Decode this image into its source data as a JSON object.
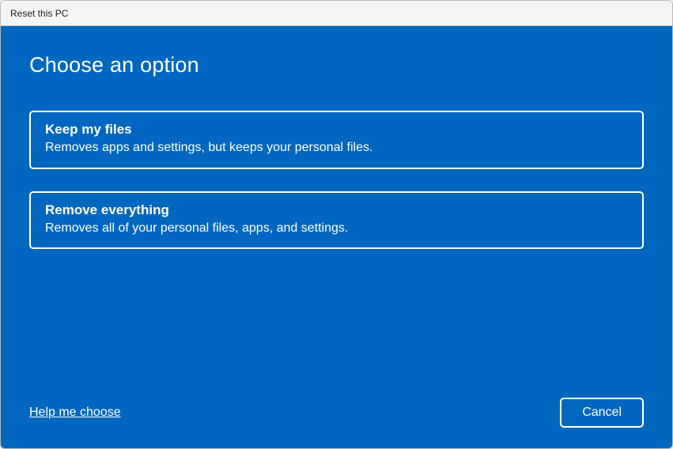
{
  "window": {
    "title": "Reset this PC"
  },
  "heading": "Choose an option",
  "options": [
    {
      "title": "Keep my files",
      "description": "Removes apps and settings, but keeps your personal files."
    },
    {
      "title": "Remove everything",
      "description": "Removes all of your personal files, apps, and settings."
    }
  ],
  "footer": {
    "help_link": "Help me choose",
    "cancel_label": "Cancel"
  },
  "colors": {
    "accent": "#0067c0"
  }
}
